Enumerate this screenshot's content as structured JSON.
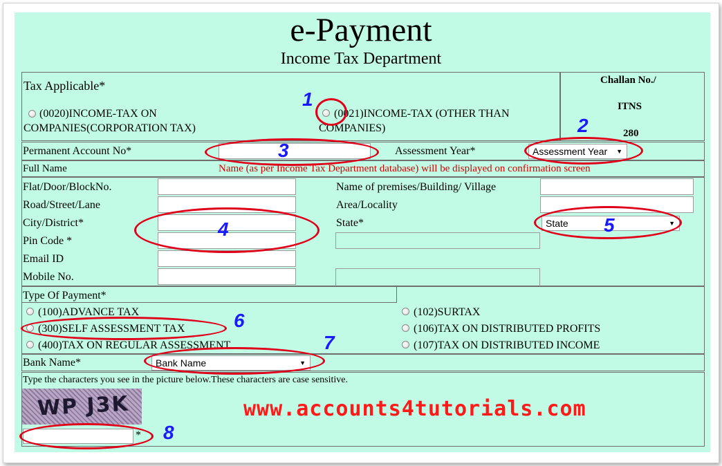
{
  "header": {
    "title": "e-Payment",
    "subtitle": "Income Tax Department"
  },
  "tax_applicable": {
    "label": "Tax Applicable*",
    "option1": "(0020)INCOME-TAX ON",
    "option1b": "COMPANIES(CORPORATION TAX)",
    "option2": "(0021)INCOME-TAX (OTHER THAN",
    "option2b": "COMPANIES)"
  },
  "challan": {
    "line1": "Challan No./",
    "line2": "ITNS",
    "line3": "280"
  },
  "pan": {
    "label": "Permanent Account No*",
    "value": ""
  },
  "assessment_year": {
    "label": "Assessment Year*",
    "selected": "Assessment Year"
  },
  "full_name": {
    "label": "Full Name",
    "note": "Name (as per Income Tax Department database) will be displayed on confirmation screen"
  },
  "address": {
    "flat_label": "Flat/Door/BlockNo.",
    "road_label": "Road/Street/Lane",
    "city_label": "City/District*",
    "pin_label": "Pin Code *",
    "email_label": "Email ID",
    "mobile_label": "Mobile No.",
    "premises_label": "Name of premises/Building/ Village",
    "area_label": "Area/Locality",
    "state_label": "State*",
    "state_selected": "State"
  },
  "payment": {
    "label": "Type Of Payment*",
    "opt100": "(100)ADVANCE TAX",
    "opt300": "(300)SELF ASSESSMENT TAX",
    "opt400": "(400)TAX ON REGULAR ASSESSMENT",
    "opt102": "(102)SURTAX",
    "opt106": "(106)TAX ON DISTRIBUTED PROFITS",
    "opt107": "(107)TAX ON DISTRIBUTED INCOME"
  },
  "bank": {
    "label": "Bank Name*",
    "selected": "Bank Name"
  },
  "captcha": {
    "instruction": "Type the characters you see in the picture below.These characters are case sensitive.",
    "image_text": "WP J3K",
    "required_mark": "*"
  },
  "watermark": "www.accounts4tutorials.com",
  "annotations": [
    "1",
    "2",
    "3",
    "4",
    "5",
    "6",
    "7",
    "8"
  ]
}
